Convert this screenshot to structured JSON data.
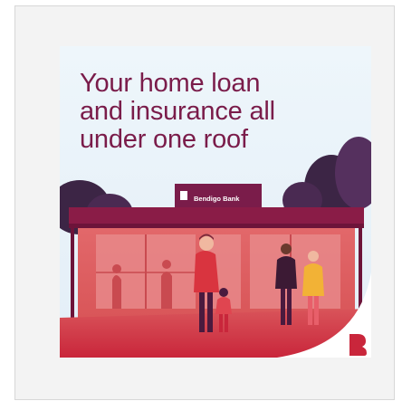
{
  "ad": {
    "headline": "Your home loan\nand insurance all\nunder one roof",
    "sign_label": "Bendigo Bank",
    "logo_icon": "bendigo-b-logo-icon",
    "colors": {
      "brand": "#7a1c4a",
      "accent_red": "#c9263b",
      "awning": "#8a1c47",
      "background": "#e8f1f8"
    }
  }
}
